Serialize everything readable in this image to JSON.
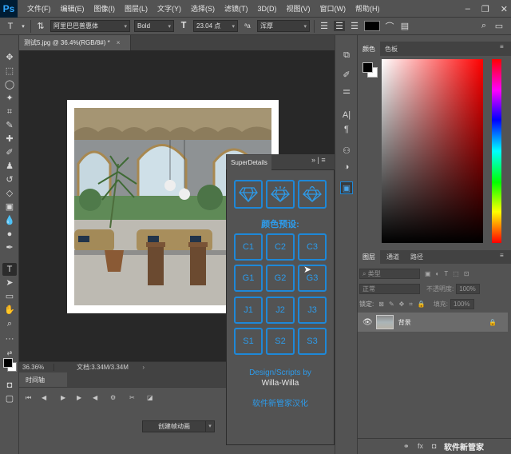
{
  "app": {
    "logo": "Ps"
  },
  "menu": [
    "文件(F)",
    "编辑(E)",
    "图像(I)",
    "图层(L)",
    "文字(Y)",
    "选择(S)",
    "滤镜(T)",
    "3D(D)",
    "视图(V)",
    "窗口(W)",
    "帮助(H)"
  ],
  "options": {
    "font_family": "阿里巴巴普惠体",
    "font_style": "Bold",
    "font_size": "23.04 点",
    "antialias": "浑厚"
  },
  "document": {
    "tab_title": "测试5.jpg @ 36.4%(RGB/8#) *",
    "close": "×",
    "zoom": "36.36%",
    "doc_info": "文档:3.34M/3.34M",
    "status_arrow": "›"
  },
  "timeline": {
    "tab": "时间轴",
    "create_button": "创建帧动画"
  },
  "superdetails": {
    "tab": "SuperDetails",
    "preset_title": "颜色预设:",
    "buttons": [
      [
        "C1",
        "C2",
        "C3"
      ],
      [
        "G1",
        "G2",
        "G3"
      ],
      [
        "J1",
        "J2",
        "J3"
      ],
      [
        "S1",
        "S2",
        "S3"
      ]
    ],
    "credit_line1": "Design/Scripts by",
    "credit_line2": "Willa-Willa",
    "credit_line3": "软件新管家汉化"
  },
  "color_panel": {
    "tabs": [
      "颜色",
      "色板"
    ]
  },
  "layers_panel": {
    "tabs": [
      "图层",
      "通道",
      "路径"
    ],
    "filter_kind": "类型",
    "blend_mode": "正常",
    "opacity_label": "不透明度:",
    "opacity_value": "100%",
    "lock_label": "锁定:",
    "fill_label": "填充:",
    "fill_value": "100%",
    "layer_name": "背景"
  },
  "watermark": "软件新管家",
  "colors": {
    "accent": "#1e88d8",
    "accent_text": "#2d9bea"
  }
}
